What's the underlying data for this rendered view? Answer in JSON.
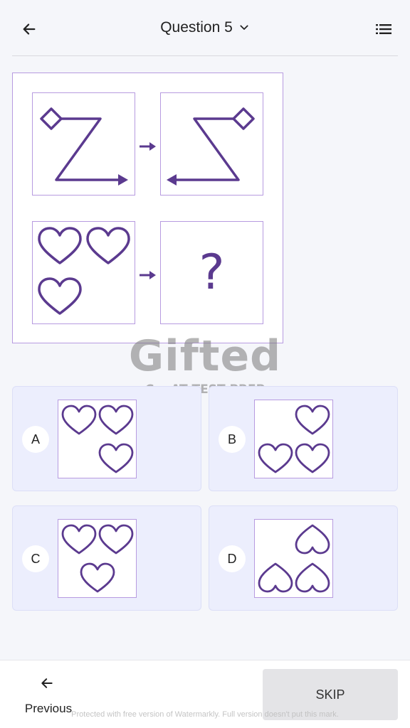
{
  "header": {
    "title": "Question 5",
    "back_icon": "arrow-left-icon",
    "dropdown_icon": "chevron-down-icon",
    "menu_icon": "list-icon"
  },
  "question": {
    "unknown_symbol": "?"
  },
  "watermark": {
    "brand": "Gifted",
    "tagline": "CogAT TEST PREP"
  },
  "options": [
    {
      "letter": "A"
    },
    {
      "letter": "B"
    },
    {
      "letter": "C"
    },
    {
      "letter": "D"
    }
  ],
  "footer": {
    "previous_label": "Previous",
    "skip_label": "SKIP",
    "watermark_note": "Protected with free version of Watermarkly. Full version doesn't put this mark."
  },
  "colors": {
    "accent_purple": "#5b3a8f",
    "border_lilac": "#b79be0",
    "option_bg": "#eceefd"
  }
}
